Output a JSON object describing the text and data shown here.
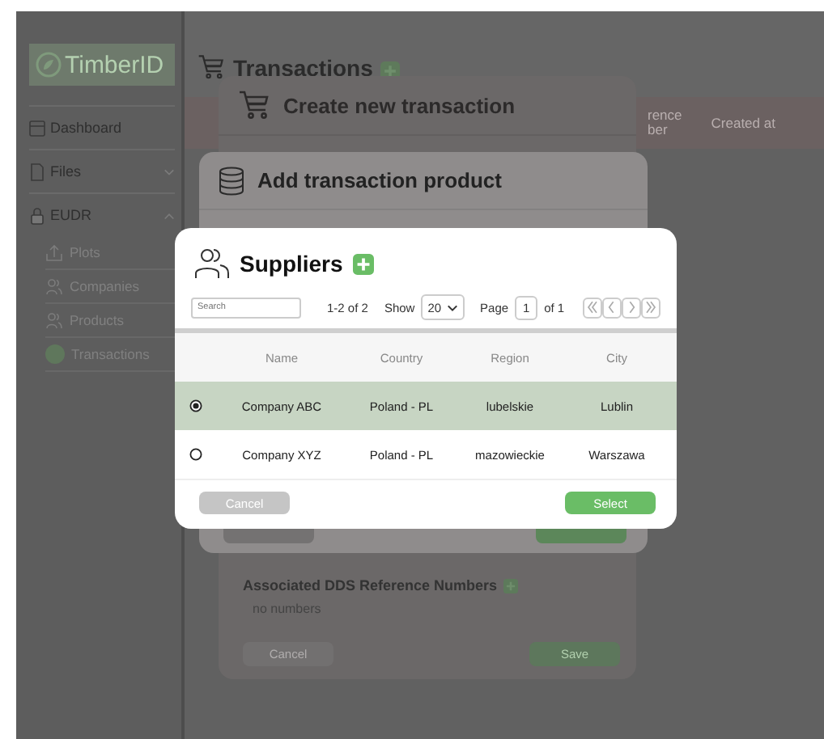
{
  "sidebar": {
    "logo": "TimberID",
    "items": [
      {
        "label": "Dashboard",
        "selected": false
      },
      {
        "label": "Files",
        "expanded": false,
        "selected": false
      },
      {
        "label": "EUDR",
        "expanded": true,
        "selected": false,
        "children": [
          {
            "label": "Plots",
            "selected": false
          },
          {
            "label": "Companies",
            "selected": false
          },
          {
            "label": "Products",
            "selected": false
          },
          {
            "label": "Transactions",
            "selected": true
          }
        ]
      }
    ]
  },
  "page_header": {
    "title": "Transactions"
  },
  "table": {
    "columns": [
      {
        "lines": [
          "rence",
          "ber"
        ]
      },
      {
        "lines": [
          "Created at"
        ]
      }
    ]
  },
  "create_transaction_dialog": {
    "title": "Create new transaction",
    "dds_section": {
      "title": "Associated DDS Reference Numbers",
      "empty_text": "no numbers"
    },
    "buttons": [
      {
        "label": "Cancel",
        "kind": "secondary"
      },
      {
        "label": "Save",
        "kind": "primary"
      }
    ]
  },
  "add_product_dialog": {
    "title": "Add transaction product"
  },
  "suppliers_dialog": {
    "title": "Suppliers",
    "search": {
      "placeholder": "Search"
    },
    "range": "1-2 of 2",
    "show_label": "Show",
    "page_size": "20",
    "page_label": "Page",
    "page": "1",
    "page_of": "of 1",
    "columns": [
      "Name",
      "Country",
      "Region",
      "City"
    ],
    "rows": [
      {
        "selected": true,
        "cells": [
          "Company ABC",
          "Poland - PL",
          "lubelskie",
          "Lublin"
        ]
      },
      {
        "selected": false,
        "cells": [
          "Company XYZ",
          "Poland - PL",
          "mazowieckie",
          "Warszawa"
        ]
      }
    ],
    "buttons": [
      {
        "label": "Cancel",
        "kind": "secondary"
      },
      {
        "label": "Select",
        "kind": "primary"
      }
    ]
  }
}
